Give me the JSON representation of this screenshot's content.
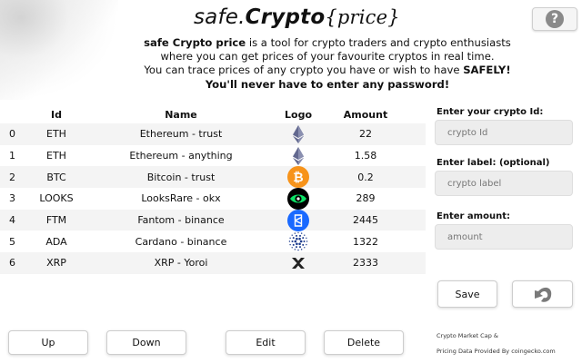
{
  "title": {
    "part1": "safe.",
    "part2": "Crypto",
    "part3": "{price}"
  },
  "help_button": {
    "glyph": "?"
  },
  "intro": {
    "line1_bold": "safe Crypto price",
    "line1_rest": " is a tool for crypto traders and crypto enthusiasts",
    "line2": "where you can get prices of your favourite cryptos in real time.",
    "line3_pre": "You can trace prices of any crypto you have or wish to have ",
    "line3_bold": "SAFELY!",
    "line4": "You'll never have to enter any password!"
  },
  "table": {
    "headers": {
      "id": "Id",
      "name": "Name",
      "logo": "Logo",
      "amount": "Amount"
    },
    "rows": [
      {
        "index": "0",
        "id": "ETH",
        "name": "Ethereum - trust",
        "logo": "eth-icon",
        "amount": "22"
      },
      {
        "index": "1",
        "id": "ETH",
        "name": "Ethereum - anything",
        "logo": "eth-icon",
        "amount": "1.58"
      },
      {
        "index": "2",
        "id": "BTC",
        "name": "Bitcoin - trust",
        "logo": "btc-icon",
        "amount": "0.2"
      },
      {
        "index": "3",
        "id": "LOOKS",
        "name": "LooksRare - okx",
        "logo": "looks-icon",
        "amount": "289"
      },
      {
        "index": "4",
        "id": "FTM",
        "name": "Fantom - binance",
        "logo": "ftm-icon",
        "amount": "2445"
      },
      {
        "index": "5",
        "id": "ADA",
        "name": "Cardano - binance",
        "logo": "ada-icon",
        "amount": "1322"
      },
      {
        "index": "6",
        "id": "XRP",
        "name": "XRP - Yoroi",
        "logo": "xrp-icon",
        "amount": "2333"
      }
    ]
  },
  "form": {
    "crypto_id": {
      "label": "Enter your crypto Id:",
      "placeholder": "crypto Id"
    },
    "crypto_label": {
      "label": "Enter label: (optional)",
      "placeholder": "crypto label"
    },
    "amount": {
      "label": "Enter amount:",
      "placeholder": "amount"
    },
    "save_label": "Save"
  },
  "bottom_buttons": {
    "up": "Up",
    "down": "Down",
    "edit": "Edit",
    "delete": "Delete"
  },
  "credits": {
    "line1": "Crypto Market Cap &",
    "line2": "Pricing Data Provided By coingecko.com"
  },
  "colors": {
    "btc": "#f7931a",
    "ftm": "#1969ff",
    "looks": "#0ce466",
    "eth": "#62688f"
  }
}
